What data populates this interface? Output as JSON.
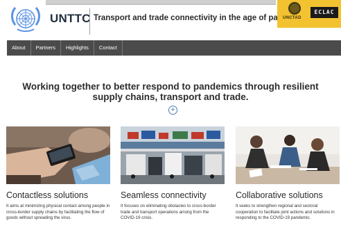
{
  "header": {
    "brand": "UNTTC",
    "tagline": "Transport and trade connectivity in the age of pander",
    "unctad_label": "UNCTAD",
    "eclac_label": "ECLAC"
  },
  "nav": {
    "items": [
      "About",
      "Partners",
      "Highlights",
      "Contact"
    ]
  },
  "hero": {
    "title": "Working together to better respond to pandemics through resilient supply chains, transport and trade.",
    "expand_symbol": "+"
  },
  "cards": [
    {
      "title": "Contactless solutions",
      "text": "It aims at minimizing physical contact among people in cross-border supply chains by facilitating the flow of goods without spreading the virus.",
      "image": "contactless-payment-photo"
    },
    {
      "title": "Seamless connectivity",
      "text": "It focuses on eliminating obstacles to cross-border trade and transport operations arising from the COVID-19 crisis.",
      "image": "trucks-border-crossing-photo"
    },
    {
      "title": "Collaborative solutions",
      "text": "It seeks to strengthen regional and sectoral cooperation to facilitate joint actions and solutions in responding to the COVID-19 pandemic.",
      "image": "team-meeting-photo"
    }
  ],
  "colors": {
    "nav_bg": "#4b4b4b",
    "partner_bg": "#f2c230",
    "un_blue": "#5b92e5",
    "link_blue": "#4a7bb0"
  }
}
